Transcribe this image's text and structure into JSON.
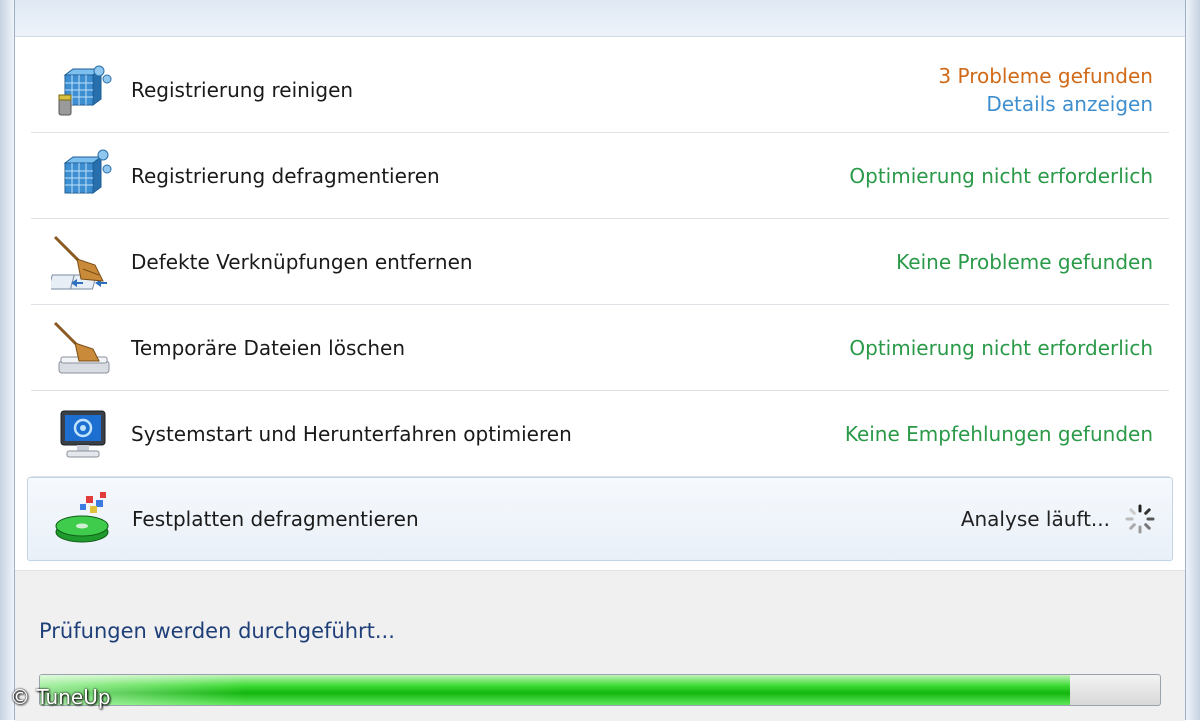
{
  "rows": [
    {
      "label": "Registrierung reinigen",
      "status": "3 Probleme gefunden",
      "link": "Details anzeigen",
      "icon": "registry-cleaner-icon"
    },
    {
      "label": "Registrierung defragmentieren",
      "status": "Optimierung nicht erforderlich",
      "icon": "registry-defrag-icon"
    },
    {
      "label": "Defekte Verknüpfungen entfernen",
      "status": "Keine Probleme gefunden",
      "icon": "broom-shortcuts-icon"
    },
    {
      "label": "Temporäre Dateien löschen",
      "status": "Optimierung nicht erforderlich",
      "icon": "broom-drive-icon"
    },
    {
      "label": "Systemstart und Herunterfahren optimieren",
      "status": "Keine Empfehlungen gefunden",
      "icon": "monitor-icon"
    },
    {
      "label": "Festplatten defragmentieren",
      "status": "Analyse läuft...",
      "icon": "disk-defrag-icon"
    }
  ],
  "footer": {
    "status_text": "Prüfungen werden durchgeführt...",
    "progress": 0.92
  },
  "watermark": "© TuneUp",
  "colors": {
    "problem": "#d06a18",
    "ok": "#2a9a49",
    "link": "#3f8fcf",
    "footer_text": "#1f3f79",
    "progress": "#13b60f"
  }
}
